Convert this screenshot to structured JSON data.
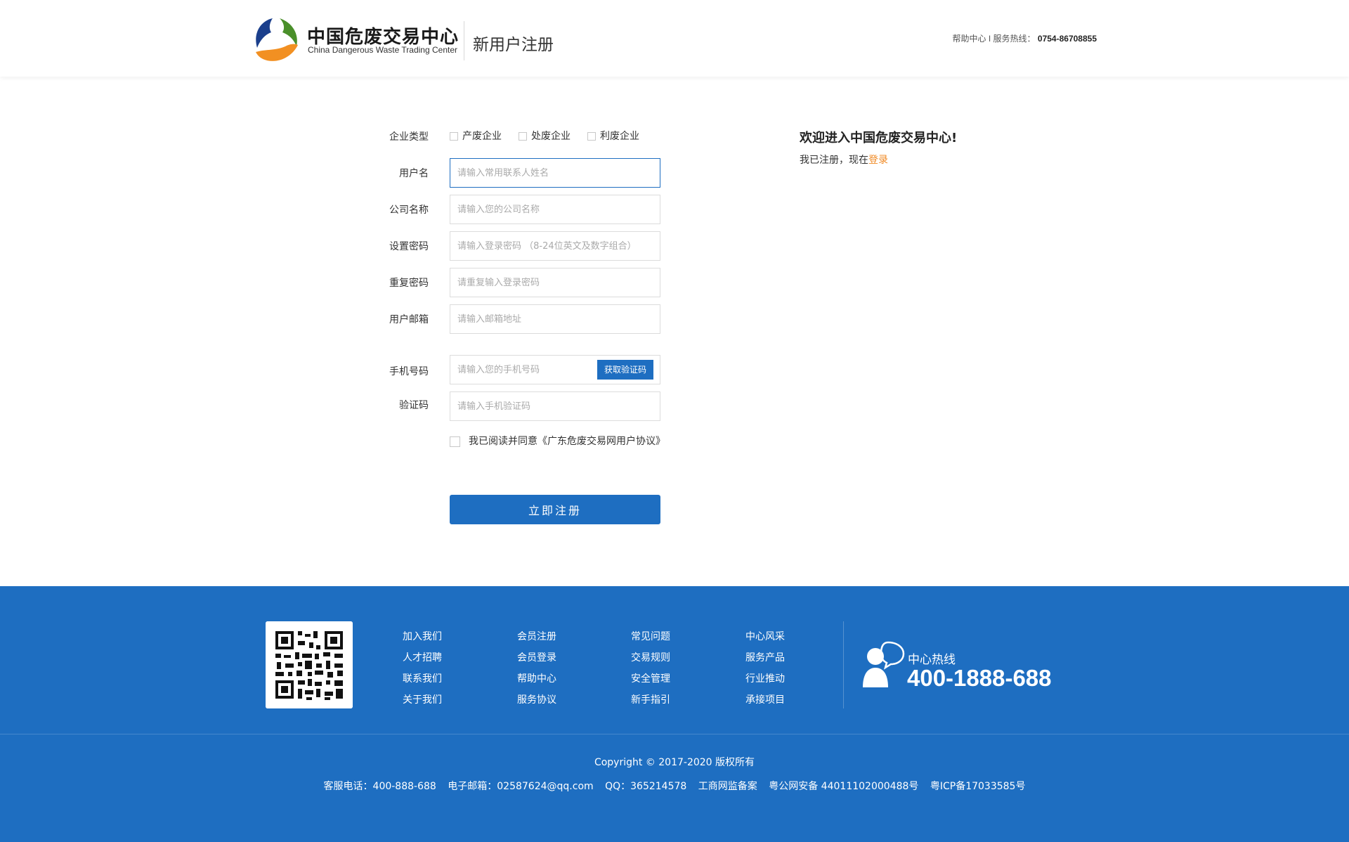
{
  "header": {
    "logo_cn": "中国危废交易中心",
    "logo_en": "China Dangerous Waste Trading Center",
    "title": "新用户注册",
    "help": "帮助中心",
    "sep": "I",
    "hotline_label": "服务热线：",
    "hotline": "0754-86708855"
  },
  "form": {
    "type_label": "企业类型",
    "type_options": [
      "产废企业",
      "处废企业",
      "利废企业"
    ],
    "username": {
      "label": "用户名",
      "placeholder": "请输入常用联系人姓名"
    },
    "company": {
      "label": "公司名称",
      "placeholder": "请输入您的公司名称"
    },
    "password": {
      "label": "设置密码",
      "placeholder": "请输入登录密码 （8-24位英文及数字组合）"
    },
    "repeat": {
      "label": "重复密码",
      "placeholder": "请重复输入登录密码"
    },
    "email": {
      "label": "用户邮箱",
      "placeholder": "请输入邮箱地址"
    },
    "phone": {
      "label": "手机号码",
      "placeholder": "请输入您的手机号码",
      "button": "获取验证码"
    },
    "code": {
      "label": "验证码",
      "placeholder": "请输入手机验证码"
    },
    "agree": "我已阅读并同意《广东危废交易网用户协议》",
    "submit": "立即注册"
  },
  "welcome": {
    "title": "欢迎进入中国危废交易中心!",
    "sub": "我已注册，现在",
    "login": "登录"
  },
  "footer": {
    "columns": [
      [
        "加入我们",
        "人才招聘",
        "联系我们",
        "关于我们"
      ],
      [
        "会员注册",
        "会员登录",
        "帮助中心",
        "服务协议"
      ],
      [
        "常见问题",
        "交易规则",
        "安全管理",
        "新手指引"
      ],
      [
        "中心风采",
        "服务产品",
        "行业推动",
        "承接项目"
      ]
    ],
    "hotline_label": "中心热线",
    "hotline": "400-1888-688",
    "copyright": "Copyright © 2017-2020  版权所有",
    "contact": [
      "客服电话：400-888-688",
      "电子邮箱：02587624@qq.com",
      "QQ：365214578",
      "工商网监备案",
      "粤公网安备 44011102000488号",
      "粤ICP备17033585号"
    ]
  },
  "colors": {
    "primary": "#1e6ec1",
    "accent": "#f08a24"
  }
}
